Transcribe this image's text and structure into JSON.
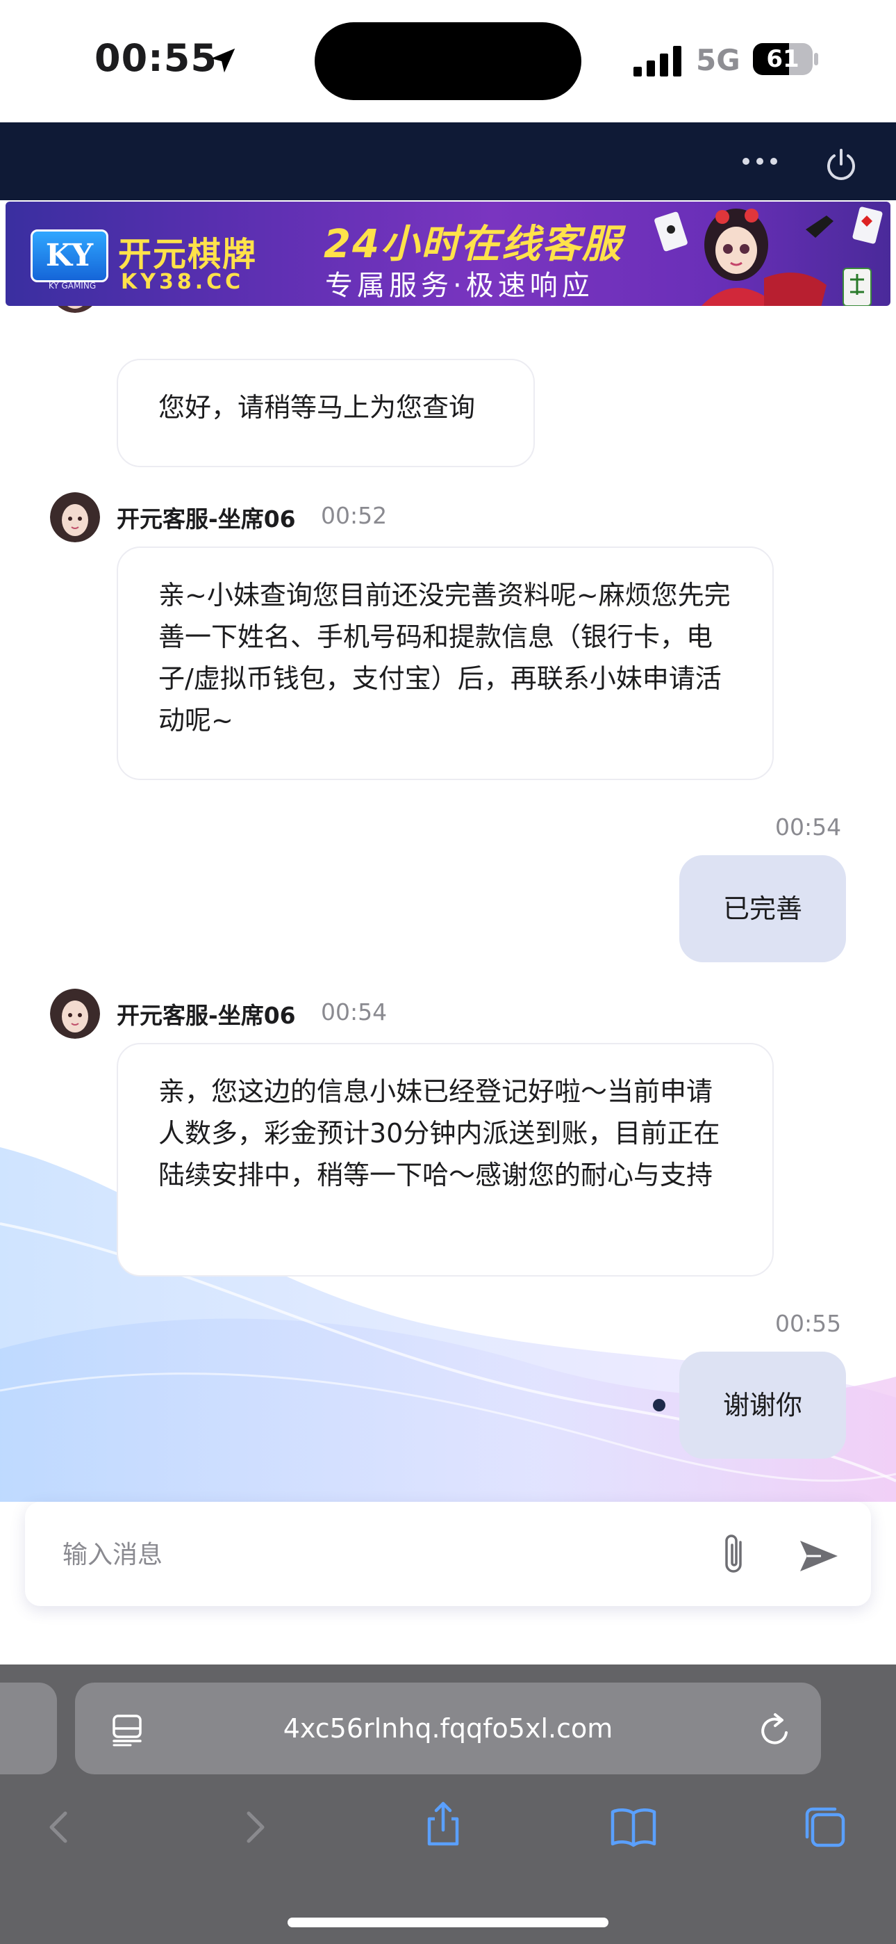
{
  "status_bar": {
    "time": "00:55",
    "network": "5G",
    "battery": "61",
    "battery_level_percent": 61
  },
  "header": {
    "menu_icon": "more-dots-icon",
    "power_icon": "power-icon"
  },
  "banner": {
    "logo": "KY",
    "logo_sub": "KY GAMING",
    "brand": "开元棋牌",
    "brand_url": "KY38.CC",
    "title": "24小时在线客服",
    "subtitle": "专属服务·极速响应"
  },
  "messages": [
    {
      "direction": "in",
      "text": "您好，请稍等马上为您查询"
    },
    {
      "direction": "in",
      "agent": "开元客服-坐席06",
      "time": "00:52",
      "text": "亲~小妹查询您目前还没完善资料呢~麻烦您先完善一下姓名、手机号码和提款信息（银行卡，电子/虚拟币钱包，支付宝）后，再联系小妹申请活动呢~"
    },
    {
      "direction": "out",
      "time": "00:54",
      "text": "已完善"
    },
    {
      "direction": "in",
      "agent": "开元客服-坐席06",
      "time": "00:54",
      "text": "亲，您这边的信息小妹已经登记好啦～当前申请人数多，彩金预计30分钟内派送到账，目前正在陆续安排中，稍等一下哈～感谢您的耐心与支持"
    },
    {
      "direction": "out",
      "time": "00:55",
      "text": "谢谢你"
    }
  ],
  "input": {
    "placeholder": "输入消息",
    "value": "",
    "attach_icon": "paperclip-icon",
    "send_icon": "send-icon"
  },
  "browser": {
    "url": "4xc56rlnhq.fqqfo5xl.com",
    "icons": [
      "reader-icon",
      "reload-icon",
      "back-icon",
      "forward-icon",
      "share-icon",
      "bookmarks-icon",
      "tabs-icon"
    ]
  },
  "colors": {
    "header_bg": "#0f1a36",
    "outgoing_bubble": "#dde2f3",
    "banner_yellow": "#ffe24a",
    "safari_bar": "#636366",
    "toolbar_icon": "#5aa0ff"
  }
}
